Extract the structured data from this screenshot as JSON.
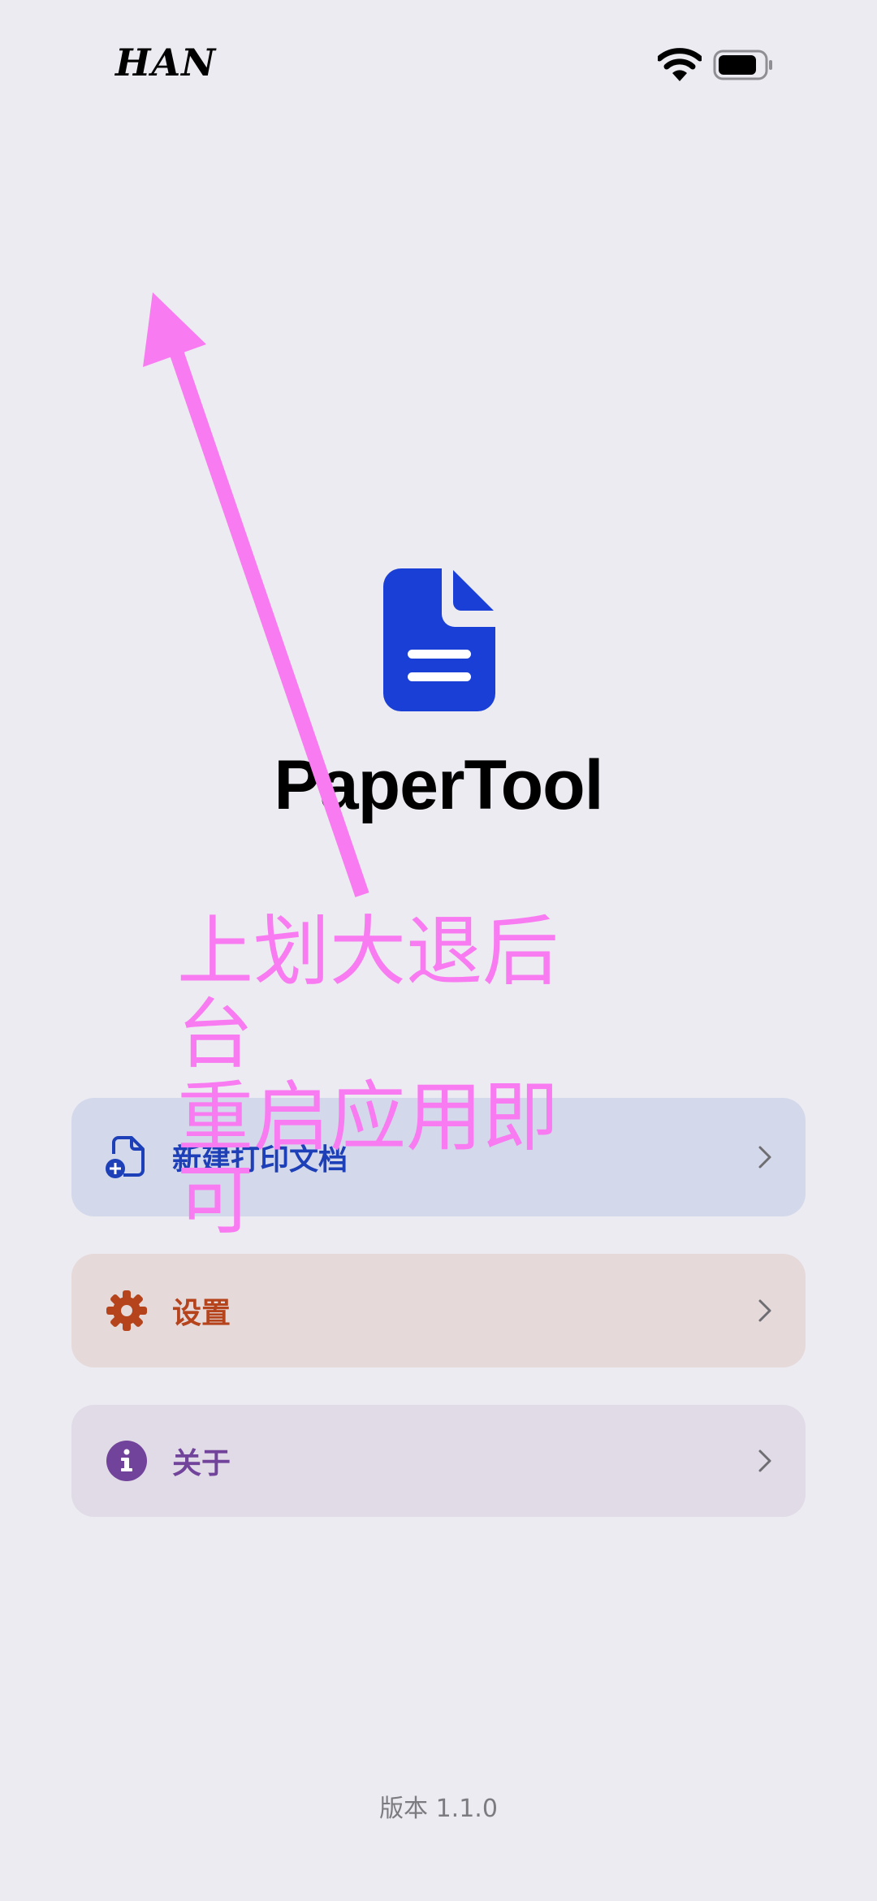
{
  "status_bar": {
    "carrier": "HAN",
    "wifi_icon": "wifi-icon",
    "battery_icon": "battery-icon"
  },
  "app": {
    "logo_icon": "document-icon",
    "title": "PaperTool",
    "brand_color": "#1a3fd6"
  },
  "annotation": {
    "line1": "上划大退后台",
    "line2": "重启应用即可",
    "color": "#f97bf1"
  },
  "menu": [
    {
      "label": "新建打印文档",
      "icon": "new-document-icon",
      "color": "#1d3fb8"
    },
    {
      "label": "设置",
      "icon": "gear-icon",
      "color": "#b5441d"
    },
    {
      "label": "关于",
      "icon": "info-icon",
      "color": "#71439b"
    }
  ],
  "footer": {
    "version": "版本 1.1.0"
  }
}
